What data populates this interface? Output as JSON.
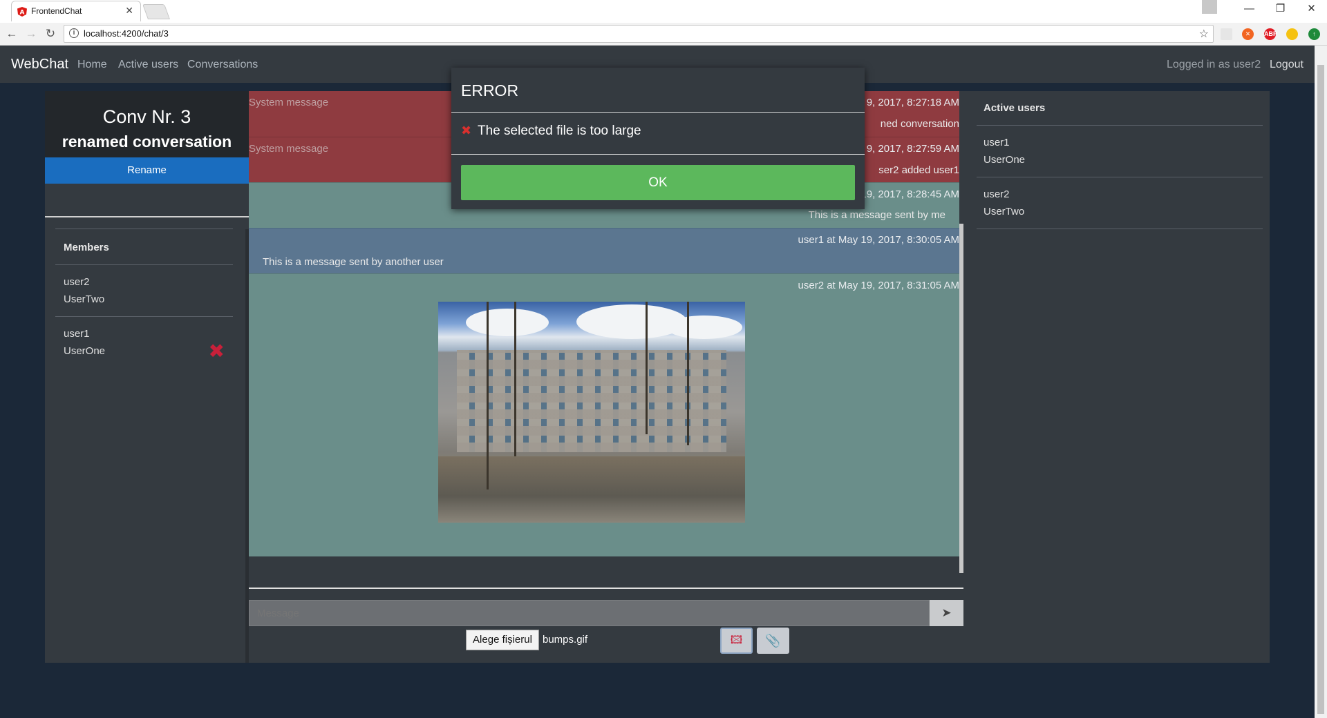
{
  "browser": {
    "tab_title": "FrontendChat",
    "tab_close": "✕",
    "url": "localhost:4200/chat/3",
    "window_buttons": {
      "minimize": "—",
      "restore": "❐",
      "close": "✕"
    },
    "nav": {
      "back": "←",
      "forward": "→",
      "reload": "↻"
    }
  },
  "navbar": {
    "brand": "WebChat",
    "links": [
      "Home",
      "Active users",
      "Conversations"
    ],
    "logged_in": "Logged in as user2",
    "logout": "Logout"
  },
  "conversation": {
    "title": "Conv Nr. 3",
    "name": "renamed conversation",
    "rename_label": "Rename"
  },
  "members": {
    "heading": "Members",
    "items": [
      {
        "username": "user2",
        "name": "UserTwo",
        "removable": false
      },
      {
        "username": "user1",
        "name": "UserOne",
        "removable": true
      }
    ],
    "remove_icon": "✖"
  },
  "messages": [
    {
      "type": "system",
      "sender": "System message",
      "time": "9, 2017, 8:27:18 AM",
      "text": "ned conversation"
    },
    {
      "type": "system",
      "sender": "System message",
      "time": "9, 2017, 8:27:59 AM",
      "text": "ser2 added user1"
    },
    {
      "type": "me",
      "header": "user2 at May 19, 2017, 8:28:45 AM",
      "text": "This is a message sent by me"
    },
    {
      "type": "other",
      "header": "user1 at May 19, 2017, 8:30:05 AM",
      "text": "This is a message sent by another user"
    },
    {
      "type": "me-image",
      "header": "user2 at May 19, 2017, 8:31:05 AM"
    }
  ],
  "composer": {
    "placeholder": "Message",
    "send_icon": "➤",
    "choose_file_label": "Alege fișierul",
    "file_name": "bumps.gif",
    "image_icon": "🖾",
    "attach_icon": "📎"
  },
  "active_users": {
    "heading": "Active users",
    "items": [
      {
        "username": "user1",
        "name": "UserOne"
      },
      {
        "username": "user2",
        "name": "UserTwo"
      }
    ]
  },
  "modal": {
    "title": "ERROR",
    "icon": "✖",
    "message": "The selected file is too large",
    "ok_label": "OK"
  },
  "colors": {
    "system_msg": "#8f3b40",
    "my_msg": "#6a8e8a",
    "other_msg": "#5b7690",
    "rename_btn": "#1a6dbf",
    "ok_btn": "#5cb85c",
    "danger": "#c9203a"
  }
}
